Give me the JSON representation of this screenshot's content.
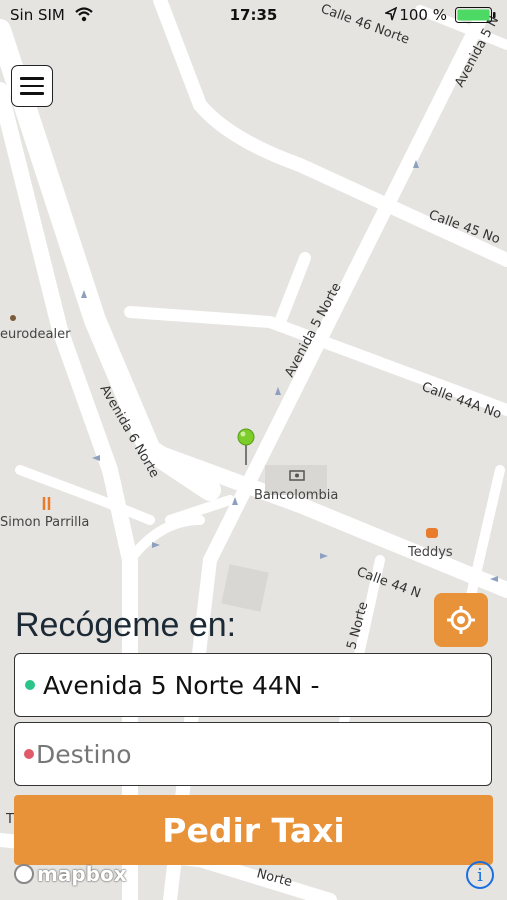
{
  "status_bar": {
    "carrier": "Sin SIM",
    "time": "17:35",
    "battery_percent": "100 %"
  },
  "map": {
    "street_labels": [
      "Calle 46 Norte",
      "Avenida 5 N",
      "Calle 45 No",
      "Avenida 5 Norte",
      "Calle 44A No",
      "Avenida 6 Norte",
      "Calle 44 N",
      "5 Norte",
      "Norte",
      "T"
    ],
    "poi_labels": [
      "eurodealer",
      "Bancolombia",
      "Teddys",
      "Simon Parrilla"
    ],
    "attribution": "mapbox"
  },
  "pickup": {
    "label": "Recógeme en:",
    "origin_value": "Avenida 5 Norte 44N -",
    "destination_placeholder": "Destino"
  },
  "action": {
    "request_label": "Pedir Taxi"
  },
  "info_label": "i",
  "colors": {
    "accent": "#e8923a",
    "origin_dot": "#2bc48a",
    "destination_dot": "#e05a6a",
    "pin": "#7ccc2a"
  }
}
